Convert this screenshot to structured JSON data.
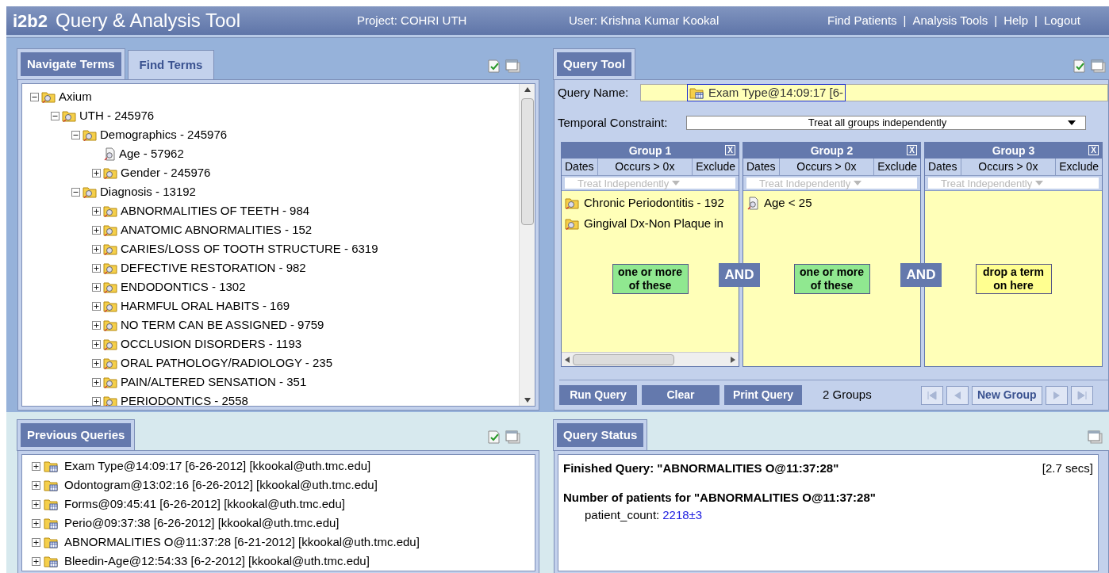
{
  "header": {
    "logo": "i2b2",
    "title": "Query & Analysis Tool",
    "project": "Project: COHRI UTH",
    "user": "User: Krishna Kumar Kookal",
    "links": [
      "Find Patients",
      "Analysis Tools",
      "Help",
      "Logout"
    ],
    "link_separator": "|"
  },
  "navigate": {
    "tabs": [
      {
        "label": "Navigate Terms",
        "selected": true
      },
      {
        "label": "Find Terms",
        "selected": false
      }
    ],
    "tree": [
      {
        "label": "Axium",
        "kind": "folder",
        "expanded": true,
        "children": [
          {
            "label": "UTH - 245976",
            "kind": "folder",
            "expanded": true,
            "children": [
              {
                "label": "Demographics - 245976",
                "kind": "folder",
                "expanded": true,
                "children": [
                  {
                    "label": "Age - 57962",
                    "kind": "leaf"
                  },
                  {
                    "label": "Gender - 245976",
                    "kind": "folder",
                    "expanded": false
                  }
                ]
              },
              {
                "label": "Diagnosis - 13192",
                "kind": "folder",
                "expanded": true,
                "children": [
                  {
                    "label": "ABNORMALITIES OF TEETH - 984",
                    "kind": "folder",
                    "expanded": false
                  },
                  {
                    "label": "ANATOMIC ABNORMALITIES - 152",
                    "kind": "folder",
                    "expanded": false
                  },
                  {
                    "label": "CARIES/LOSS OF TOOTH STRUCTURE - 6319",
                    "kind": "folder",
                    "expanded": false
                  },
                  {
                    "label": "DEFECTIVE RESTORATION - 982",
                    "kind": "folder",
                    "expanded": false
                  },
                  {
                    "label": "ENDODONTICS - 1302",
                    "kind": "folder",
                    "expanded": false
                  },
                  {
                    "label": "HARMFUL ORAL HABITS - 169",
                    "kind": "folder",
                    "expanded": false
                  },
                  {
                    "label": "NO TERM CAN BE ASSIGNED - 9759",
                    "kind": "folder",
                    "expanded": false
                  },
                  {
                    "label": "OCCLUSION DISORDERS - 1193",
                    "kind": "folder",
                    "expanded": false
                  },
                  {
                    "label": "ORAL PATHOLOGY/RADIOLOGY - 235",
                    "kind": "folder",
                    "expanded": false
                  },
                  {
                    "label": "PAIN/ALTERED SENSATION - 351",
                    "kind": "folder",
                    "expanded": false
                  },
                  {
                    "label": "PERIODONTICS - 2558",
                    "kind": "folder",
                    "expanded": false
                  }
                ]
              }
            ]
          }
        ]
      }
    ]
  },
  "query_tool": {
    "tab": {
      "label": "Query Tool",
      "selected": true
    },
    "query_name_label": "Query Name:",
    "query_name": "Exam Type@14:09:17 [6-",
    "temporal_label": "Temporal Constraint:",
    "temporal_value": "Treat all groups independently",
    "groups": [
      {
        "title": "Group 1",
        "close": "X",
        "buttons": [
          "Dates",
          "Occurs > 0x",
          "Exclude"
        ],
        "timing": "Treat Independently",
        "items": [
          {
            "label": "Chronic Periodontitis - 192",
            "kind": "folder"
          },
          {
            "label": "Gingival Dx-Non Plaque in",
            "kind": "folder"
          }
        ],
        "hint": {
          "text": "one or more of these",
          "kind": "filled"
        },
        "scrollbar": true
      },
      {
        "title": "Group 2",
        "close": "X",
        "buttons": [
          "Dates",
          "Occurs > 0x",
          "Exclude"
        ],
        "timing": "Treat Independently",
        "items": [
          {
            "label": "Age < 25",
            "kind": "leaf"
          }
        ],
        "hint": {
          "text": "one or more of these",
          "kind": "filled"
        },
        "scrollbar": false
      },
      {
        "title": "Group 3",
        "close": "X",
        "buttons": [
          "Dates",
          "Occurs > 0x",
          "Exclude"
        ],
        "timing": "Treat Independently",
        "hint": {
          "text": "drop a term on here",
          "kind": "empty"
        },
        "scrollbar": false
      }
    ],
    "connectors": [
      "AND",
      "AND"
    ],
    "actions": [
      "Run Query",
      "Clear",
      "Print Query"
    ],
    "group_count": "2 Groups",
    "nav": [
      {
        "kind": "first",
        "disabled": true
      },
      {
        "kind": "prev",
        "disabled": true
      },
      {
        "kind": "text",
        "label": "New Group",
        "disabled": false
      },
      {
        "kind": "next",
        "disabled": true
      },
      {
        "kind": "last",
        "disabled": true
      }
    ]
  },
  "previous_queries": {
    "tab": {
      "label": "Previous Queries",
      "selected": true
    },
    "items": [
      {
        "label": "Exam Type@14:09:17 [6-26-2012] [kkookal@uth.tmc.edu]"
      },
      {
        "label": "Odontogram@13:02:16 [6-26-2012] [kkookal@uth.tmc.edu]"
      },
      {
        "label": "Forms@09:45:41 [6-26-2012] [kkookal@uth.tmc.edu]"
      },
      {
        "label": "Perio@09:37:38 [6-26-2012] [kkookal@uth.tmc.edu]"
      },
      {
        "label": "ABNORMALITIES O@11:37:28 [6-21-2012] [kkookal@uth.tmc.edu]"
      },
      {
        "label": "Bleedin-Age@12:54:33 [6-2-2012] [kkookal@uth.tmc.edu]"
      }
    ]
  },
  "query_status": {
    "tab": {
      "label": "Query Status",
      "selected": true
    },
    "finished": "Finished Query: \"ABNORMALITIES O@11:37:28\"",
    "duration": "[2.7 secs]",
    "result_title": "Number of patients for \"ABNORMALITIES O@11:37:28\"",
    "count_label": "patient_count:",
    "count_value": "2218±3"
  }
}
